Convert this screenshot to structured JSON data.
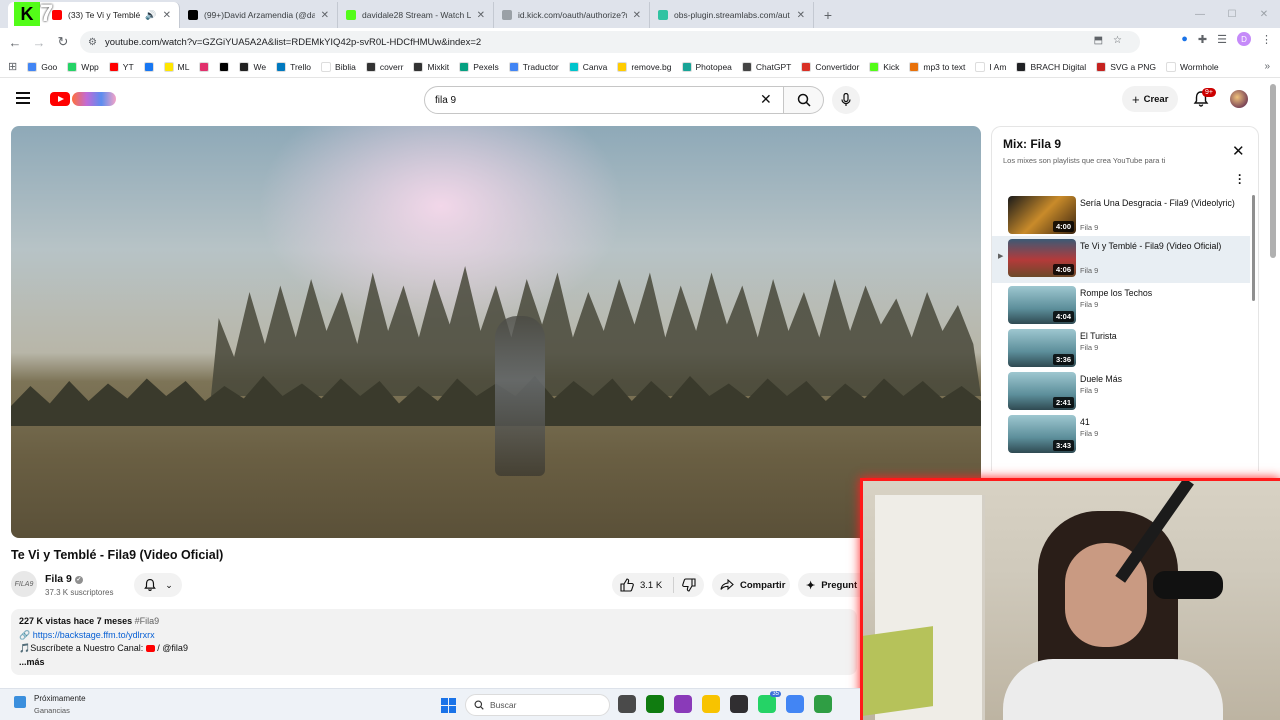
{
  "browser": {
    "tabs": [
      {
        "title": "(33) Te Vi y Temblé - Fila9",
        "active": true,
        "icon_color": "#ff0000"
      },
      {
        "title": "(99+)David Arzamendia (@dav",
        "active": false,
        "icon_color": "#000000"
      },
      {
        "title": "davidale28 Stream - Watch Live",
        "active": false,
        "icon_color": "#53fc18"
      },
      {
        "title": "id.kick.com/oauth/authorize?re",
        "active": false,
        "icon_color": "#9aa0a6"
      },
      {
        "title": "obs-plugin.streamlabs.com/aut",
        "active": false,
        "icon_color": "#31c3a2"
      }
    ],
    "url": "youtube.com/watch?v=GZGiYUA5A2A&list=RDEMkYIQ42p-svR0L-HDCfHMUw&index=2",
    "profile_initial": "D",
    "bookmarks": [
      {
        "label": "Goo",
        "color": "#4285f4"
      },
      {
        "label": "Wpp",
        "color": "#25d366"
      },
      {
        "label": "YT",
        "color": "#ff0000"
      },
      {
        "label": "",
        "color": "#1877f2"
      },
      {
        "label": "ML",
        "color": "#ffe600"
      },
      {
        "label": "",
        "color": "#e1306c"
      },
      {
        "label": "",
        "color": "#000000"
      },
      {
        "label": "We",
        "color": "#222222"
      },
      {
        "label": "Trello",
        "color": "#0079bf"
      },
      {
        "label": "Biblia",
        "color": "#ffffff"
      },
      {
        "label": "coverr",
        "color": "#333333"
      },
      {
        "label": "Mixkit",
        "color": "#333333"
      },
      {
        "label": "Pexels",
        "color": "#05a081"
      },
      {
        "label": "Traductor",
        "color": "#4285f4"
      },
      {
        "label": "Canva",
        "color": "#00c4cc"
      },
      {
        "label": "remove.bg",
        "color": "#ffcc00"
      },
      {
        "label": "Photopea",
        "color": "#18a497"
      },
      {
        "label": "ChatGPT",
        "color": "#444444"
      },
      {
        "label": "Convertidor",
        "color": "#d93025"
      },
      {
        "label": "Kick",
        "color": "#53fc18"
      },
      {
        "label": "mp3 to text",
        "color": "#e8710a"
      },
      {
        "label": "I Am",
        "color": "#ffffff"
      },
      {
        "label": "BRACH Digital",
        "color": "#202124"
      },
      {
        "label": "SVG a PNG",
        "color": "#c5221f"
      },
      {
        "label": "Wormhole",
        "color": "#ffffff"
      }
    ]
  },
  "youtube": {
    "search_value": "fila 9",
    "create_label": "Crear",
    "notifications_badge": "9+",
    "video": {
      "title": "Te Vi y Temblé - Fila9 (Video Oficial)",
      "channel": "Fila 9",
      "channel_avatar_text": "FILA9",
      "subscribers": "37.3 K suscriptores",
      "likes": "3.1 K",
      "share_label": "Compartir",
      "ask_label": "Pregunt",
      "views": "227 K vistas",
      "published": "hace 7 meses",
      "hashtag": "#Fila9",
      "link": "https://backstage.ffm.to/ydlrxrx",
      "subscribe_line": "🎵Suscríbete a Nuestro Canal:",
      "channel_handle": "/ @fila9",
      "more_label": "...más"
    },
    "playlist": {
      "title": "Mix: Fila 9",
      "subtitle": "Los mixes son playlists que crea YouTube para ti",
      "items": [
        {
          "title": "Sería Una Desgracia - Fila9 (Videolyric)",
          "channel": "Fila 9",
          "duration": "4:00",
          "current": false
        },
        {
          "title": "Te Vi y Temblé - Fila9 (Video Oficial)",
          "channel": "Fila 9",
          "duration": "4:06",
          "current": true
        },
        {
          "title": "Rompe los Techos",
          "channel": "Fila 9",
          "duration": "4:04",
          "current": false
        },
        {
          "title": "El Turista",
          "channel": "Fila 9",
          "duration": "3:36",
          "current": false
        },
        {
          "title": "Duele Más",
          "channel": "Fila 9",
          "duration": "2:41",
          "current": false
        },
        {
          "title": "41",
          "channel": "Fila 9",
          "duration": "3:43",
          "current": false
        }
      ]
    }
  },
  "taskbar": {
    "weather_line1": "Próximamente",
    "weather_line2": "Ganancias",
    "search_placeholder": "Buscar",
    "apps": [
      {
        "name": "task-view",
        "color": "#4a4a4a",
        "badge": ""
      },
      {
        "name": "xbox",
        "color": "#107c10",
        "badge": ""
      },
      {
        "name": "app-purple",
        "color": "#8a3ab9",
        "badge": ""
      },
      {
        "name": "file-explorer",
        "color": "#f8c300",
        "badge": ""
      },
      {
        "name": "obs",
        "color": "#302e31",
        "badge": ""
      },
      {
        "name": "whatsapp",
        "color": "#25d366",
        "badge": "35"
      },
      {
        "name": "chrome",
        "color": "#4285f4",
        "badge": ""
      },
      {
        "name": "app-green",
        "color": "#2f9e44",
        "badge": ""
      }
    ]
  }
}
